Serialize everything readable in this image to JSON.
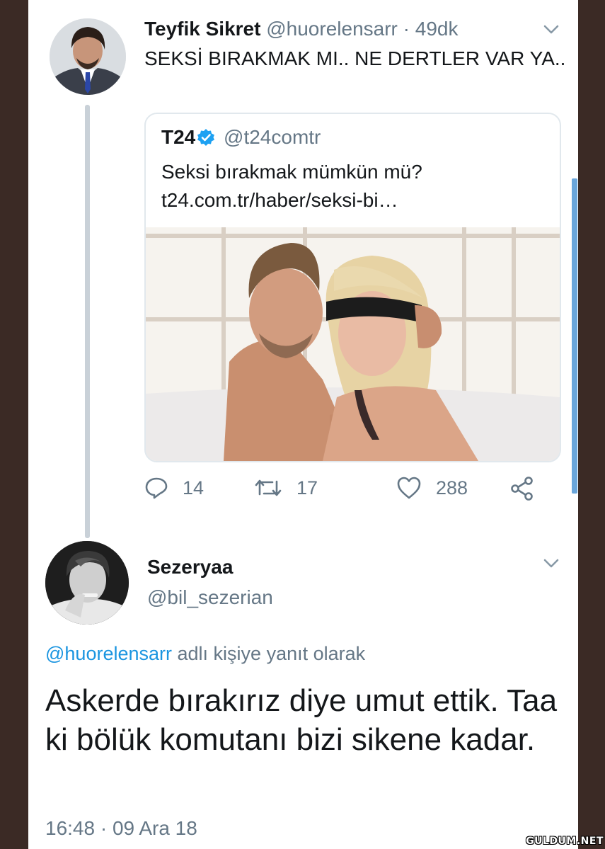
{
  "tweet": {
    "author_name": "Teyfik Sikret",
    "author_handle": "@huorelensarr",
    "separator": "·",
    "time_ago": "49dk",
    "text": "SEKSİ BIRAKMAK MI.. NE DERTLER VAR YA..",
    "avatar_icon": "man-in-suit-avatar"
  },
  "quoted": {
    "name": "T24",
    "handle": "@t24comtr",
    "text": "Seksi bırakmak mümkün mü? t24.com.tr/haber/seksi-bi…",
    "image_description_icon": "couple-photo"
  },
  "actions": {
    "replies": "14",
    "retweets": "17",
    "likes": "288"
  },
  "reply": {
    "author_name": "Sezeryaa",
    "author_handle": "@bil_sezerian",
    "replying_to_mention": "@huorelensarr",
    "replying_to_suffix": "adlı kişiye yanıt olarak",
    "text": "Askerde bırakırız diye umut ettik. Taa ki bölük komutanı bizi sikene kadar.",
    "timestamp": "16:48 · 09 Ara 18",
    "avatar_icon": "bw-portrait-avatar"
  },
  "watermark": "GULDUM.NET",
  "colors": {
    "link": "#1b95e0",
    "muted": "#657786",
    "text": "#14171a",
    "verified": "#1da1f2"
  }
}
